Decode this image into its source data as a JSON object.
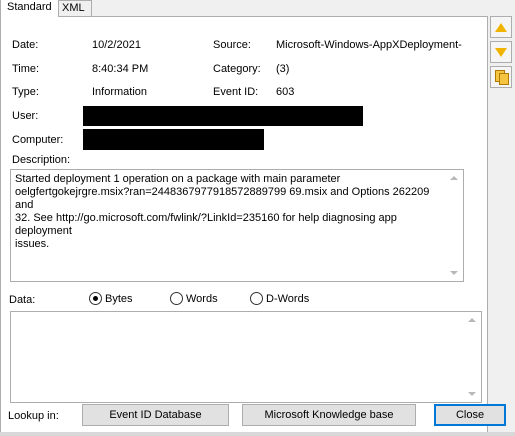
{
  "tabs": [
    {
      "label": "Standard",
      "active": true
    },
    {
      "label": "XML",
      "active": false
    }
  ],
  "fields": {
    "date_label": "Date:",
    "date_value": "10/2/2021",
    "source_label": "Source:",
    "source_value": "Microsoft-Windows-AppXDeployment-",
    "time_label": "Time:",
    "time_value": "8:40:34 PM",
    "category_label": "Category:",
    "category_value": "(3)",
    "type_label": "Type:",
    "type_value": "Information",
    "event_id_label": "Event ID:",
    "event_id_value": "603",
    "user_label": "User:",
    "computer_label": "Computer:",
    "description_label": "Description:"
  },
  "description_text": "Started deployment 1 operation on a package with main parameter\noelgfertgokejrgre.msix?ran=2448367977918572889799 69.msix and Options 262209 and\n32. See http://go.microsoft.com/fwlink/?LinkId=235160 for help diagnosing app deployment\nissues.",
  "data_section": {
    "label": "Data:",
    "options": [
      {
        "label": "Bytes",
        "checked": true
      },
      {
        "label": "Words",
        "checked": false
      },
      {
        "label": "D-Words",
        "checked": false
      }
    ]
  },
  "footer": {
    "lookup_label": "Lookup in:",
    "event_id_db_button": "Event ID Database",
    "kb_button": "Microsoft Knowledge base",
    "close_button": "Close"
  },
  "colors": {
    "arrow": "#f0b400",
    "default_button_border": "#0078d7",
    "redaction": "#000000"
  }
}
